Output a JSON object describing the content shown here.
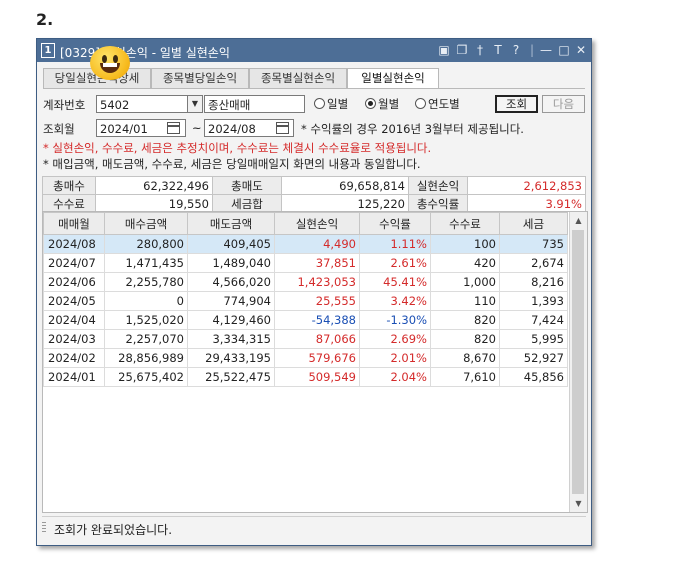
{
  "heading": "2.",
  "window": {
    "number": "1",
    "title": "[0329] 실현손익 - 일별 실현손익",
    "title_icons": [
      "window-icon",
      "copy-icon",
      "pin-icon",
      "text-icon",
      "help-icon",
      "minimize-icon",
      "maximize-icon",
      "close-icon"
    ],
    "help_label": "?",
    "text_label": "T"
  },
  "tabs": [
    {
      "label": "당일실현손익상세",
      "active": false
    },
    {
      "label": "종목별당일손익",
      "active": false
    },
    {
      "label": "종목별실현손익",
      "active": false
    },
    {
      "label": "일별실현손익",
      "active": true
    }
  ],
  "filters": {
    "account_label": "계좌번호",
    "account_value": "5402",
    "account_name": "종산매매",
    "period_options": [
      "일별",
      "월별",
      "연도별"
    ],
    "period_selected": "월별",
    "search_button": "조회",
    "next_button": "다음",
    "query_period_label": "조회월",
    "date_from": "2024/01",
    "date_separator": "~",
    "date_to": "2024/08",
    "notice_1": "* 수익률의 경우 2016년 3월부터 제공됩니다.",
    "notice_2": "* 실현손익, 수수료, 세금은 추정치이며, 수수료는 체결시 수수료율로 적용됩니다.",
    "notice_3": "* 매입금액, 매도금액, 수수료, 세금은 당일매매일지 화면의 내용과 동일합니다."
  },
  "summary": {
    "total_buy_label": "총매수",
    "total_buy": "62,322,496",
    "total_sell_label": "총매도",
    "total_sell": "69,658,814",
    "realized_pl_label": "실현손익",
    "realized_pl": "2,612,853",
    "fee_label": "수수료",
    "fee": "19,550",
    "tax_label": "세금합",
    "tax": "125,220",
    "total_return_label": "총수익률",
    "total_return": "3.91%"
  },
  "table": {
    "columns": [
      "매매월",
      "매수금액",
      "매도금액",
      "실현손익",
      "수익률",
      "수수료",
      "세금"
    ],
    "rows": [
      {
        "month": "2024/08",
        "buy": "280,800",
        "sell": "409,405",
        "pl": "4,490",
        "rate": "1.11%",
        "fee": "100",
        "tax": "735",
        "sign": "pos",
        "selected": true
      },
      {
        "month": "2024/07",
        "buy": "1,471,435",
        "sell": "1,489,040",
        "pl": "37,851",
        "rate": "2.61%",
        "fee": "420",
        "tax": "2,674",
        "sign": "pos"
      },
      {
        "month": "2024/06",
        "buy": "2,255,780",
        "sell": "4,566,020",
        "pl": "1,423,053",
        "rate": "45.41%",
        "fee": "1,000",
        "tax": "8,216",
        "sign": "pos"
      },
      {
        "month": "2024/05",
        "buy": "0",
        "sell": "774,904",
        "pl": "25,555",
        "rate": "3.42%",
        "fee": "110",
        "tax": "1,393",
        "sign": "pos"
      },
      {
        "month": "2024/04",
        "buy": "1,525,020",
        "sell": "4,129,460",
        "pl": "-54,388",
        "rate": "-1.30%",
        "fee": "820",
        "tax": "7,424",
        "sign": "neg"
      },
      {
        "month": "2024/03",
        "buy": "2,257,070",
        "sell": "3,334,315",
        "pl": "87,066",
        "rate": "2.69%",
        "fee": "820",
        "tax": "5,995",
        "sign": "pos"
      },
      {
        "month": "2024/02",
        "buy": "28,856,989",
        "sell": "29,433,195",
        "pl": "579,676",
        "rate": "2.01%",
        "fee": "8,670",
        "tax": "52,927",
        "sign": "pos"
      },
      {
        "month": "2024/01",
        "buy": "25,675,402",
        "sell": "25,522,475",
        "pl": "509,549",
        "rate": "2.04%",
        "fee": "7,610",
        "tax": "45,856",
        "sign": "pos"
      }
    ]
  },
  "status": "조회가 완료되었습니다.",
  "colors": {
    "positive": "#d42a2a",
    "negative": "#1a4fb4",
    "titlebar": "#4d6e96",
    "selected_row": "#d5e8f7"
  }
}
